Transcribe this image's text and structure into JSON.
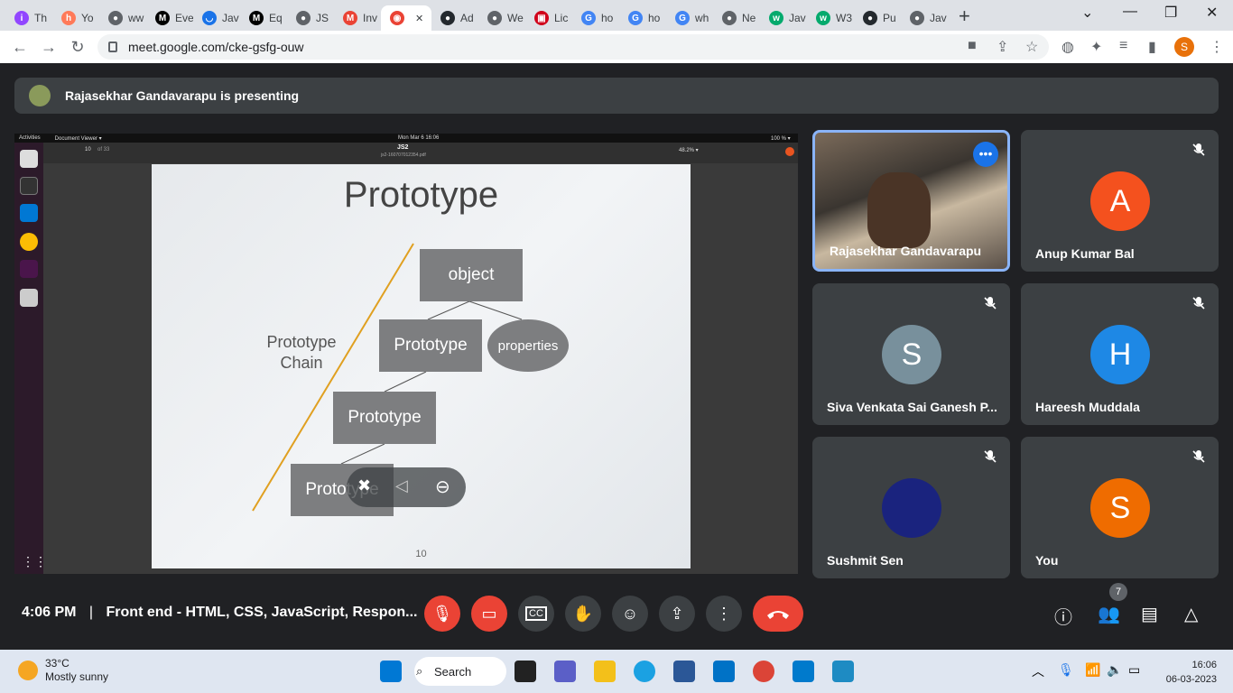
{
  "browser": {
    "tabs": [
      {
        "label": "Th",
        "icon": "twitch-icon",
        "color": "#9146ff",
        "glyph": "i"
      },
      {
        "label": "Yo",
        "icon": "hubspot-icon",
        "color": "#ff7a59",
        "glyph": "h"
      },
      {
        "label": "ww",
        "icon": "globe-icon",
        "color": "#5f6368",
        "glyph": "●"
      },
      {
        "label": "Eve",
        "icon": "medium-icon",
        "color": "#000000",
        "glyph": "M"
      },
      {
        "label": "Jav",
        "icon": "loading-icon",
        "color": "#1a73e8",
        "glyph": "◡"
      },
      {
        "label": "Eq",
        "icon": "medium-icon",
        "color": "#000000",
        "glyph": "M"
      },
      {
        "label": "JS",
        "icon": "globe-icon",
        "color": "#5f6368",
        "glyph": "●"
      },
      {
        "label": "Inv",
        "icon": "gmail-icon",
        "color": "#ea4335",
        "glyph": "M"
      },
      {
        "label": "",
        "icon": "recording-icon",
        "color": "#ea4335",
        "glyph": "◉",
        "active": true
      },
      {
        "label": "Ad",
        "icon": "github-icon",
        "color": "#24292e",
        "glyph": "●"
      },
      {
        "label": "We",
        "icon": "globe-icon",
        "color": "#5f6368",
        "glyph": "●"
      },
      {
        "label": "Lic",
        "icon": "bank-icon",
        "color": "#d0021b",
        "glyph": "▣"
      },
      {
        "label": "ho",
        "icon": "google-icon",
        "color": "#4285f4",
        "glyph": "G"
      },
      {
        "label": "ho",
        "icon": "google-icon",
        "color": "#4285f4",
        "glyph": "G"
      },
      {
        "label": "wh",
        "icon": "google-icon",
        "color": "#4285f4",
        "glyph": "G"
      },
      {
        "label": "Ne",
        "icon": "globe-icon",
        "color": "#5f6368",
        "glyph": "●"
      },
      {
        "label": "Jav",
        "icon": "w3schools-icon",
        "color": "#04aa6d",
        "glyph": "w"
      },
      {
        "label": "W3",
        "icon": "w3schools-icon",
        "color": "#04aa6d",
        "glyph": "w"
      },
      {
        "label": "Pu",
        "icon": "github-icon",
        "color": "#24292e",
        "glyph": "●"
      },
      {
        "label": "Jav",
        "icon": "globe-icon",
        "color": "#5f6368",
        "glyph": "●"
      }
    ],
    "new_tab": "+",
    "url": "meet.google.com/cke-gsfg-ouw",
    "profile_initial": "S"
  },
  "meet": {
    "presenting_text": "Rajasekhar Gandavarapu is presenting",
    "shared_screen": {
      "topbar_left": "Activities",
      "app_menu": "Document Viewer ▾",
      "datetime": "Mon Mar 6  16:06",
      "doc_title": "JS2",
      "doc_file": "js2-160707012354.pdf",
      "page_current": "10",
      "page_of": "of 33",
      "zoom": "48.2% ▾",
      "battery": "100 % ▾",
      "slide": {
        "title": "Prototype",
        "boxes": [
          "object",
          "Prototype",
          "Prototype",
          "Prototype"
        ],
        "oval": "properties",
        "chain_label_1": "Prototype",
        "chain_label_2": "Chain",
        "page_number": "10"
      }
    },
    "participants": [
      {
        "name": "Rajasekhar Gandavarapu",
        "type": "video",
        "highlight": true
      },
      {
        "name": "Anup Kumar Bal",
        "initial": "A",
        "color": "#f4511e",
        "muted": true
      },
      {
        "name": "Siva Venkata Sai Ganesh P...",
        "initial": "S",
        "color": "#78909c",
        "muted": true
      },
      {
        "name": "Hareesh Muddala",
        "initial": "H",
        "color": "#1e88e5",
        "muted": true
      },
      {
        "name": "Sushmit Sen",
        "initial": "",
        "color": "#1a237e",
        "muted": true,
        "avatar_icon": "astronaut-avatar-icon"
      },
      {
        "name": "You",
        "initial": "S",
        "color": "#ef6c00",
        "muted": true
      }
    ],
    "time": "4:06 PM",
    "separator": "|",
    "meeting_title": "Front end - HTML, CSS, JavaScript, Respon...",
    "people_count": "7",
    "accent_red": "#ea4335",
    "accent_blue": "#8ab4f8"
  },
  "taskbar": {
    "temperature": "33°C",
    "weather": "Mostly sunny",
    "search_label": "Search",
    "time": "16:06",
    "date": "06-03-2023"
  }
}
